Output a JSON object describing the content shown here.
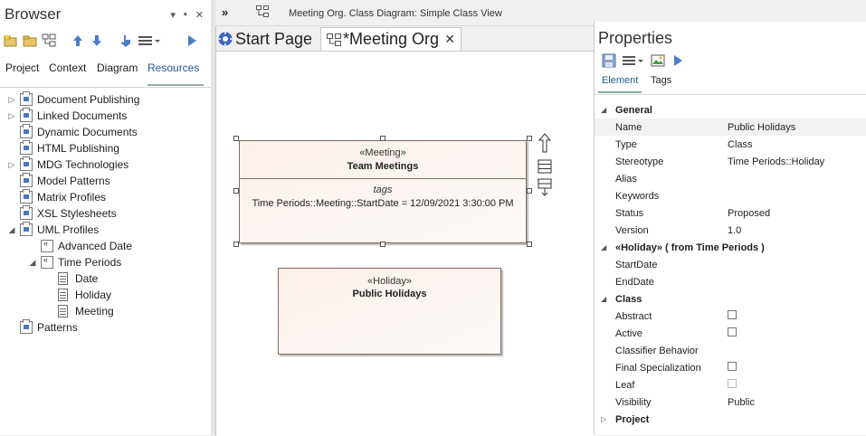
{
  "browser": {
    "title": "Browser",
    "header_icons": [
      "▾",
      "▪",
      "✕"
    ],
    "tabs": [
      {
        "label": "Project"
      },
      {
        "label": "Context"
      },
      {
        "label": "Diagram"
      },
      {
        "label": "Resources"
      }
    ],
    "tree": [
      {
        "label": "Document Publishing",
        "icon": "package-icon",
        "expander": "▷"
      },
      {
        "label": "Linked Documents",
        "icon": "package-icon",
        "expander": "▷"
      },
      {
        "label": "Dynamic Documents",
        "icon": "package-icon",
        "expander": ""
      },
      {
        "label": "HTML Publishing",
        "icon": "package-icon",
        "expander": ""
      },
      {
        "label": "MDG Technologies",
        "icon": "package-icon",
        "expander": "▷"
      },
      {
        "label": "Model Patterns",
        "icon": "package-icon",
        "expander": ""
      },
      {
        "label": "Matrix Profiles",
        "icon": "package-icon",
        "expander": ""
      },
      {
        "label": "XSL Stylesheets",
        "icon": "package-icon",
        "expander": ""
      },
      {
        "label": "UML Profiles",
        "icon": "package-icon",
        "expander": "◢"
      },
      {
        "label": "Advanced Date",
        "icon": "profile-icon",
        "expander": ""
      },
      {
        "label": "Time Periods",
        "icon": "profile-icon",
        "expander": "◢"
      },
      {
        "label": "Date",
        "icon": "class-icon",
        "expander": ""
      },
      {
        "label": "Holiday",
        "icon": "class-icon",
        "expander": ""
      },
      {
        "label": "Meeting",
        "icon": "class-icon",
        "expander": ""
      },
      {
        "label": "Patterns",
        "icon": "package-icon",
        "expander": ""
      }
    ]
  },
  "topbar": {
    "path": "Meeting Org.  Class Diagram: Simple Class View"
  },
  "doc_tabs": {
    "start_label": "Start Page",
    "meeting_label": "*Meeting Org",
    "close_glyph": "✕"
  },
  "diagram": {
    "meeting": {
      "stereotype": "«Meeting»",
      "name": "Team Meetings",
      "tags_title": "tags",
      "tag_value": "Time Periods::Meeting::StartDate = 12/09/2021 3:30:00 PM"
    },
    "holiday": {
      "stereotype": "«Holiday»",
      "name": "Public Holidays"
    }
  },
  "properties": {
    "title": "Properties",
    "tabs": [
      {
        "label": "Element"
      },
      {
        "label": "Tags"
      }
    ],
    "sections": {
      "general": "General",
      "holiday": "«Holiday»  ( from Time Periods )",
      "class": "Class",
      "project": "Project"
    },
    "general": {
      "name_k": "Name",
      "name_v": "Public Holidays",
      "type_k": "Type",
      "type_v": "Class",
      "stereo_k": "Stereotype",
      "stereo_v": "Time Periods::Holiday",
      "alias_k": "Alias",
      "keywords_k": "Keywords",
      "status_k": "Status",
      "status_v": "Proposed",
      "version_k": "Version",
      "version_v": "1.0"
    },
    "holiday": {
      "start_k": "StartDate",
      "end_k": "EndDate"
    },
    "class": {
      "abstract_k": "Abstract",
      "active_k": "Active",
      "classifier_k": "Classifier Behavior",
      "final_k": "Final Specialization",
      "leaf_k": "Leaf",
      "visibility_k": "Visibility",
      "visibility_v": "Public"
    }
  }
}
